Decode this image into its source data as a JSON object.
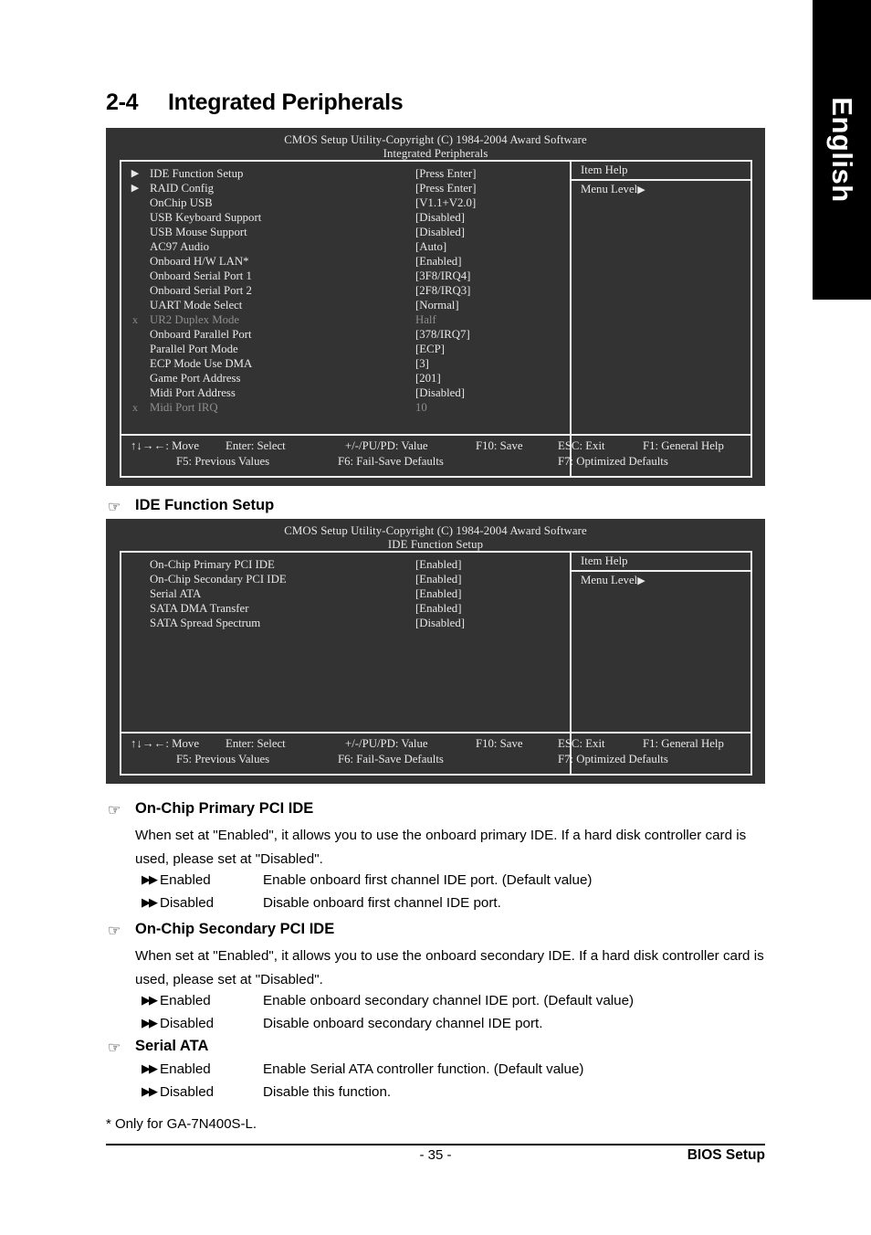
{
  "language_tab": {
    "label": "English"
  },
  "section": {
    "number": "2-4",
    "title": "Integrated Peripherals"
  },
  "bios_panel_1": {
    "title_line1": "CMOS Setup Utility-Copyright (C) 1984-2004 Award Software",
    "title_line2": "Integrated Peripherals",
    "help": {
      "title": "Item Help",
      "level": "Menu Level",
      "level_arrow": "▶"
    },
    "rows": [
      {
        "mark": "▶",
        "label": "IDE Function Setup",
        "value": "[Press Enter]",
        "dim": false
      },
      {
        "mark": "▶",
        "label": "RAID Config",
        "value": "[Press Enter]",
        "dim": false
      },
      {
        "mark": "",
        "label": "OnChip USB",
        "value": "[V1.1+V2.0]",
        "dim": false
      },
      {
        "mark": "",
        "label": "USB Keyboard Support",
        "value": "[Disabled]",
        "dim": false
      },
      {
        "mark": "",
        "label": "USB Mouse Support",
        "value": "[Disabled]",
        "dim": false
      },
      {
        "mark": "",
        "label": "AC97 Audio",
        "value": "[Auto]",
        "dim": false
      },
      {
        "mark": "",
        "label": "Onboard H/W LAN*",
        "value": "[Enabled]",
        "dim": false
      },
      {
        "mark": "",
        "label": "Onboard Serial Port 1",
        "value": "[3F8/IRQ4]",
        "dim": false
      },
      {
        "mark": "",
        "label": "Onboard Serial Port 2",
        "value": "[2F8/IRQ3]",
        "dim": false
      },
      {
        "mark": "",
        "label": "UART Mode Select",
        "value": "[Normal]",
        "dim": false
      },
      {
        "mark": "x",
        "label": "UR2 Duplex Mode",
        "value": "Half",
        "dim": true
      },
      {
        "mark": "",
        "label": "Onboard Parallel Port",
        "value": "[378/IRQ7]",
        "dim": false
      },
      {
        "mark": "",
        "label": "Parallel Port Mode",
        "value": "[ECP]",
        "dim": false
      },
      {
        "mark": "",
        "label": "ECP Mode Use DMA",
        "value": "[3]",
        "dim": false
      },
      {
        "mark": "",
        "label": "Game Port Address",
        "value": "[201]",
        "dim": false
      },
      {
        "mark": "",
        "label": "Midi Port Address",
        "value": "[Disabled]",
        "dim": false
      },
      {
        "mark": "x",
        "label": "Midi Port IRQ",
        "value": "10",
        "dim": true
      }
    ],
    "footer": {
      "move": "↑↓→←: Move",
      "enter": "Enter: Select",
      "value": "+/-/PU/PD: Value",
      "save": "F10: Save",
      "exit": "ESC: Exit",
      "help": "F1: General Help",
      "prev": "F5: Previous Values",
      "failsafe": "F6: Fail-Save Defaults",
      "optimized": "F7: Optimized Defaults"
    }
  },
  "heading_ide_function_setup": {
    "hand": "☞",
    "label": "IDE Function Setup"
  },
  "bios_panel_2": {
    "title_line1": "CMOS Setup Utility-Copyright (C) 1984-2004 Award Software",
    "title_line2": "IDE Function Setup",
    "help": {
      "title": "Item Help",
      "level": "Menu Level",
      "level_arrow": "▶"
    },
    "rows": [
      {
        "mark": "",
        "label": "On-Chip Primary PCI IDE",
        "value": "[Enabled]",
        "dim": false
      },
      {
        "mark": "",
        "label": "On-Chip Secondary PCI IDE",
        "value": "[Enabled]",
        "dim": false
      },
      {
        "mark": "",
        "label": "Serial ATA",
        "value": "[Enabled]",
        "dim": false
      },
      {
        "mark": "",
        "label": "SATA DMA Transfer",
        "value": "[Enabled]",
        "dim": false
      },
      {
        "mark": "",
        "label": "SATA Spread Spectrum",
        "value": "[Disabled]",
        "dim": false
      }
    ],
    "footer": {
      "move": "↑↓→←: Move",
      "enter": "Enter: Select",
      "value": "+/-/PU/PD: Value",
      "save": "F10: Save",
      "exit": "ESC: Exit",
      "help": "F1: General Help",
      "prev": "F5: Previous Values",
      "failsafe": "F6: Fail-Save Defaults",
      "optimized": "F7: Optimized Defaults"
    }
  },
  "doc_sections": [
    {
      "hand": "☞",
      "heading": "On-Chip Primary PCI IDE",
      "paragraph": "When set at \"Enabled\", it allows you to use the onboard primary IDE. If a hard disk controller card is used, please set at \"Disabled\".",
      "options": [
        {
          "marker": "▶▶",
          "name": "Enabled",
          "desc": "Enable onboard first channel IDE port. (Default value)"
        },
        {
          "marker": "▶▶",
          "name": "Disabled",
          "desc": "Disable onboard first channel IDE port."
        }
      ]
    },
    {
      "hand": "☞",
      "heading": "On-Chip Secondary PCI IDE",
      "paragraph": "When set at \"Enabled\", it allows you to use the onboard secondary IDE. If a hard disk controller card is used, please set at \"Disabled\".",
      "options": [
        {
          "marker": "▶▶",
          "name": "Enabled",
          "desc": "Enable onboard secondary channel IDE port. (Default value)"
        },
        {
          "marker": "▶▶",
          "name": "Disabled",
          "desc": "Disable onboard secondary channel IDE port."
        }
      ]
    },
    {
      "hand": "☞",
      "heading": "Serial ATA",
      "paragraph": "",
      "options": [
        {
          "marker": "▶▶",
          "name": "Enabled",
          "desc": "Enable Serial ATA controller function. (Default value)"
        },
        {
          "marker": "▶▶",
          "name": "Disabled",
          "desc": "Disable this function."
        }
      ]
    }
  ],
  "footnote": "* Only for GA-7N400S-L.",
  "page_footer": {
    "page_number": "- 35 -",
    "section_name": "BIOS Setup"
  }
}
